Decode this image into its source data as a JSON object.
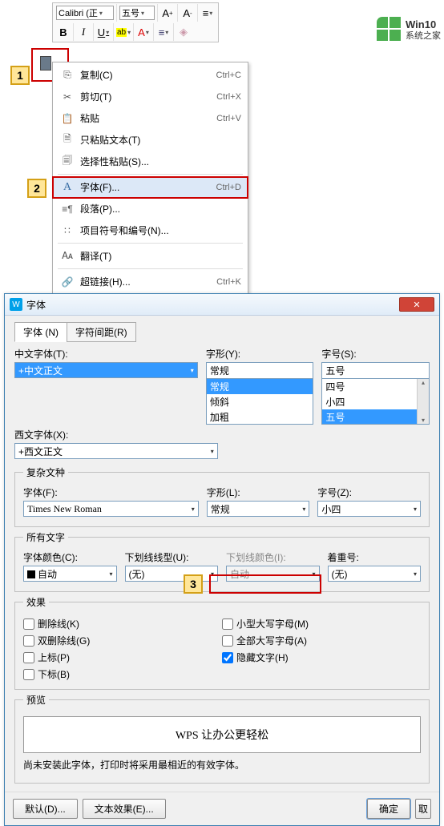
{
  "toolbar": {
    "font_name": "Calibri (正",
    "font_size": "五号"
  },
  "callouts": {
    "c1": "1",
    "c2": "2",
    "c3": "3"
  },
  "menu": {
    "copy": {
      "label": "复制(C)",
      "shortcut": "Ctrl+C"
    },
    "cut": {
      "label": "剪切(T)",
      "shortcut": "Ctrl+X"
    },
    "paste": {
      "label": "粘贴",
      "shortcut": "Ctrl+V"
    },
    "paste_text": {
      "label": "只粘贴文本(T)",
      "shortcut": ""
    },
    "paste_special": {
      "label": "选择性粘贴(S)...",
      "shortcut": ""
    },
    "font": {
      "label": "字体(F)...",
      "shortcut": "Ctrl+D"
    },
    "para": {
      "label": "段落(P)...",
      "shortcut": ""
    },
    "bullets": {
      "label": "项目符号和编号(N)...",
      "shortcut": ""
    },
    "translate": {
      "label": "翻译(T)",
      "shortcut": ""
    },
    "hyperlink": {
      "label": "超链接(H)...",
      "shortcut": "Ctrl+K"
    }
  },
  "dialog": {
    "title": "字体",
    "tabs": {
      "font": "字体 (N)",
      "spacing": "字符间距(R)"
    },
    "cn_font_label": "中文字体(T):",
    "cn_font_value": "+中文正文",
    "style_label": "字形(Y):",
    "style_value": "常规",
    "style_opts": [
      "常规",
      "倾斜",
      "加粗"
    ],
    "size_label": "字号(S):",
    "size_value": "五号",
    "size_opts": [
      "四号",
      "小四",
      "五号"
    ],
    "western_label": "西文字体(X):",
    "western_value": "+西文正文",
    "complex_label": "复杂文种",
    "complex_font_label": "字体(F):",
    "complex_font_value": "Times New Roman",
    "complex_style_label": "字形(L):",
    "complex_style_value": "常规",
    "complex_size_label": "字号(Z):",
    "complex_size_value": "小四",
    "all_text_label": "所有文字",
    "color_label": "字体颜色(C):",
    "color_value": "自动",
    "under_label": "下划线线型(U):",
    "under_value": "(无)",
    "under_color_label": "下划线颜色(I):",
    "under_color_value": "自动",
    "emphasis_label": "着重号:",
    "emphasis_value": "(无)",
    "effects_label": "效果",
    "effects": {
      "strike": "删除线(K)",
      "dstrike": "双删除线(G)",
      "super": "上标(P)",
      "sub": "下标(B)",
      "smallcaps": "小型大写字母(M)",
      "allcaps": "全部大写字母(A)",
      "hidden": "隐藏文字(H)"
    },
    "preview_label": "预览",
    "preview_text": "WPS 让办公更轻松",
    "hint": "尚未安装此字体，打印时将采用最相近的有效字体。",
    "btn_default": "默认(D)...",
    "btn_texteffect": "文本效果(E)...",
    "btn_ok": "确定",
    "btn_cancel": "取"
  },
  "watermark": {
    "line1": "Win10",
    "line2": "系统之家"
  }
}
